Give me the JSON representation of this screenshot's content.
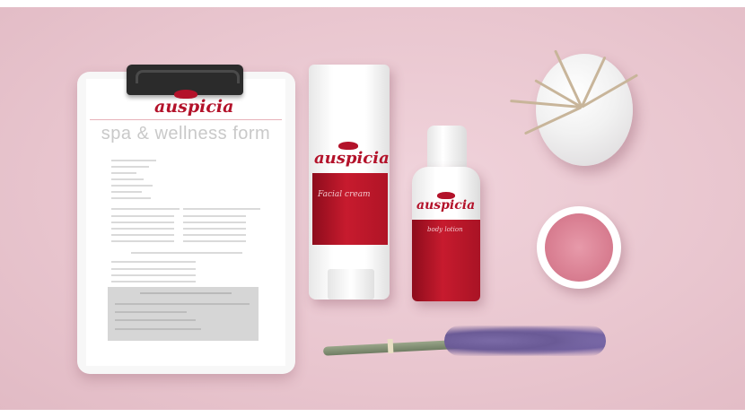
{
  "image": {
    "brand": "auspicia",
    "form": {
      "title": "spa & wellness form"
    },
    "products": [
      {
        "name": "Facial cream"
      },
      {
        "name": "body lotion"
      }
    ],
    "colors": {
      "background": "#e9c6cf",
      "brand_red": "#b3122a",
      "paper": "#ffffff"
    }
  }
}
